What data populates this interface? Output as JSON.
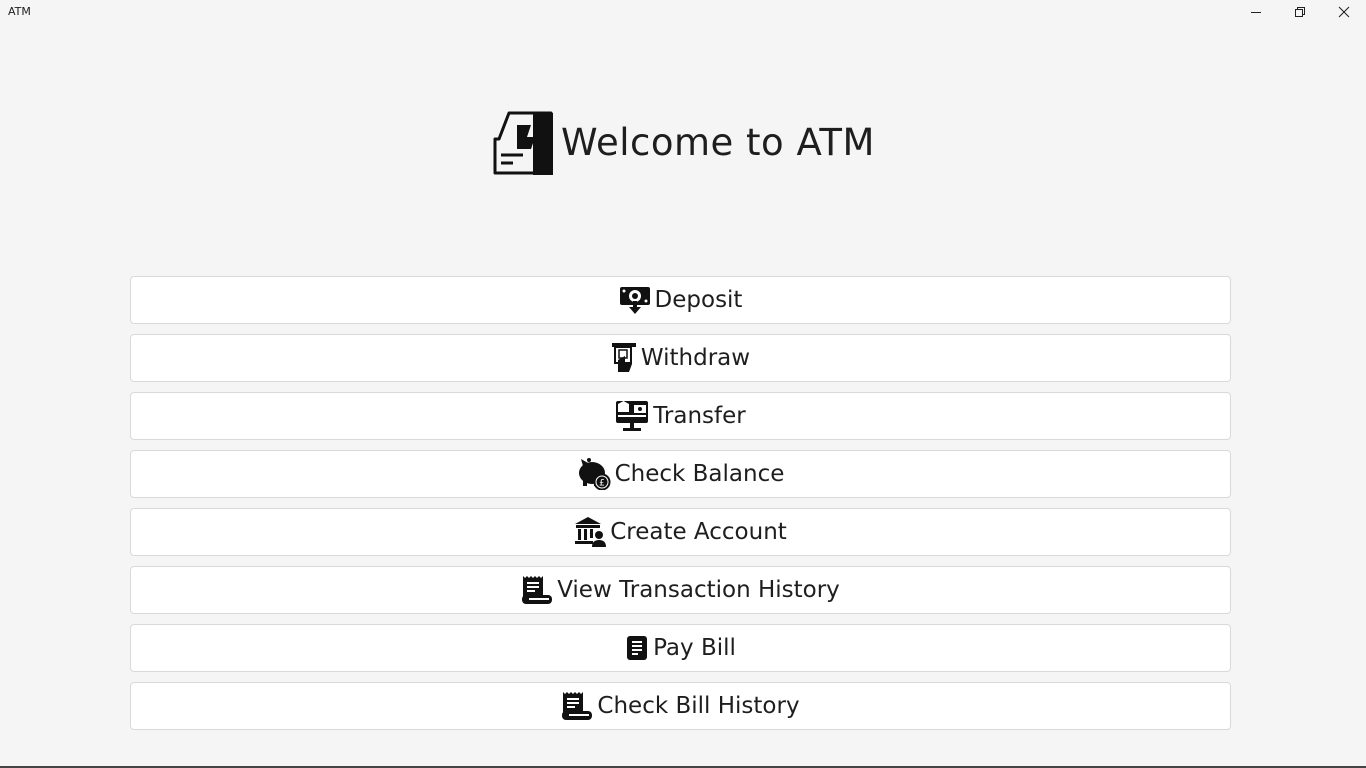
{
  "window": {
    "title": "ATM",
    "controls": [
      "minimize",
      "maximize",
      "close"
    ]
  },
  "hero": {
    "icon": "atm-icon",
    "title": "Welcome to ATM"
  },
  "menu": [
    {
      "id": "deposit",
      "label": "Deposit",
      "icon": "cash-deposit-icon"
    },
    {
      "id": "withdraw",
      "label": "Withdraw",
      "icon": "atm-withdraw-icon"
    },
    {
      "id": "transfer",
      "label": "Transfer",
      "icon": "money-transfer-icon"
    },
    {
      "id": "check-balance",
      "label": "Check Balance",
      "icon": "piggy-bank-icon"
    },
    {
      "id": "create-account",
      "label": "Create Account",
      "icon": "bank-user-icon"
    },
    {
      "id": "view-transaction-history",
      "label": "View Transaction History",
      "icon": "receipt-scroll-icon"
    },
    {
      "id": "pay-bill",
      "label": "Pay Bill",
      "icon": "bill-icon"
    },
    {
      "id": "check-bill-history",
      "label": "Check Bill History",
      "icon": "receipt-scroll-icon"
    }
  ]
}
